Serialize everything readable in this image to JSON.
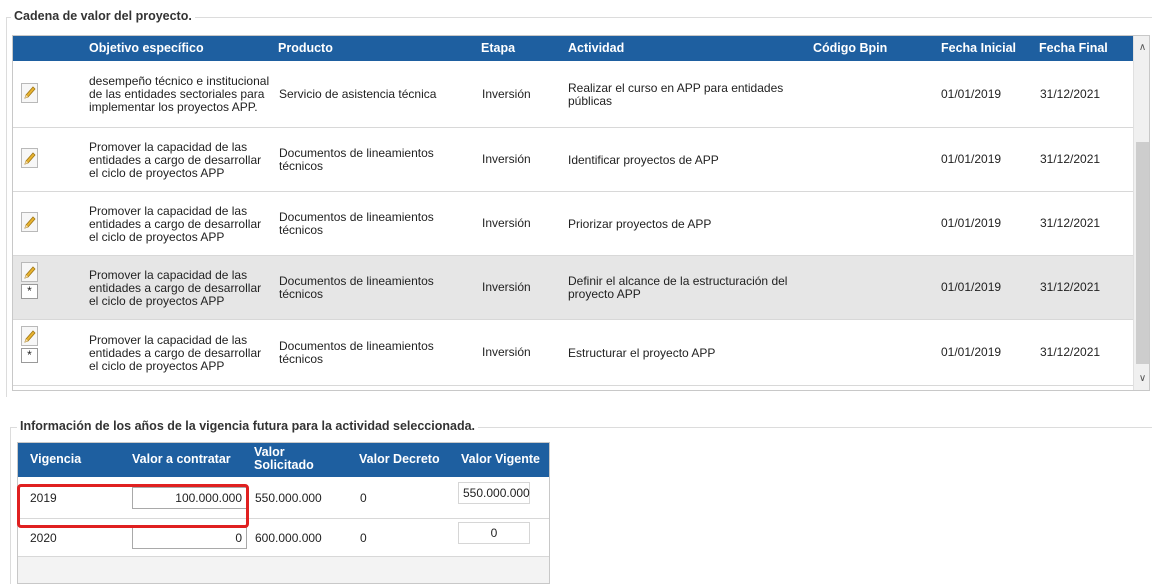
{
  "section1_title": "Cadena de valor del proyecto.",
  "grid": {
    "headers": {
      "objetivo": "Objetivo específico",
      "producto": "Producto",
      "etapa": "Etapa",
      "actividad": "Actividad",
      "codigo": "Código Bpin",
      "fecha_inicial": "Fecha Inicial",
      "fecha_final": "Fecha Final"
    },
    "rows": [
      {
        "objetivo": [
          "desempeño técnico e institucional",
          "de las entidades sectoriales para",
          "implementar los proyectos APP."
        ],
        "producto": [
          "Servicio de asistencia técnica"
        ],
        "etapa": "Inversión",
        "actividad": [
          "Realizar el curso en APP para entidades",
          "públicas"
        ],
        "fecha_inicial": "01/01/2019",
        "fecha_final": "31/12/2021",
        "selected": false,
        "star": false
      },
      {
        "objetivo": [
          "Promover la capacidad de las",
          "entidades a cargo de desarrollar",
          "el ciclo de proyectos APP"
        ],
        "producto": [
          "Documentos de lineamientos",
          "técnicos"
        ],
        "etapa": "Inversión",
        "actividad": [
          "Identificar proyectos de APP"
        ],
        "fecha_inicial": "01/01/2019",
        "fecha_final": "31/12/2021",
        "selected": false,
        "star": false
      },
      {
        "objetivo": [
          "Promover la capacidad de las",
          "entidades a cargo de desarrollar",
          "el ciclo de proyectos APP"
        ],
        "producto": [
          "Documentos de lineamientos",
          "técnicos"
        ],
        "etapa": "Inversión",
        "actividad": [
          "Priorizar proyectos de APP"
        ],
        "fecha_inicial": "01/01/2019",
        "fecha_final": "31/12/2021",
        "selected": false,
        "star": false
      },
      {
        "objetivo": [
          "Promover la capacidad de las",
          "entidades a cargo de desarrollar",
          "el ciclo de proyectos APP"
        ],
        "producto": [
          "Documentos de lineamientos",
          "técnicos"
        ],
        "etapa": "Inversión",
        "actividad": [
          "Definir el alcance de la estructuración del",
          "proyecto APP"
        ],
        "fecha_inicial": "01/01/2019",
        "fecha_final": "31/12/2021",
        "selected": true,
        "star": true
      },
      {
        "objetivo": [
          "Promover la capacidad de las",
          "entidades a cargo de desarrollar",
          "el ciclo de proyectos APP"
        ],
        "producto": [
          "Documentos de lineamientos",
          "técnicos"
        ],
        "etapa": "Inversión",
        "actividad": [
          "Estructurar el proyecto APP"
        ],
        "fecha_inicial": "01/01/2019",
        "fecha_final": "31/12/2021",
        "selected": false,
        "star": true
      }
    ],
    "star_glyph": "*"
  },
  "section2_title": "Información de los años de la vigencia futura para la actividad seleccionada.",
  "subgrid": {
    "headers": {
      "vigencia": "Vigencia",
      "valor_contratar": "Valor a contratar",
      "valor_solicitado": "Valor Solicitado",
      "valor_decreto": "Valor Decreto",
      "valor_vigente": "Valor Vigente"
    },
    "rows": [
      {
        "vigencia": "2019",
        "valor_contratar": "100.000.000",
        "valor_solicitado": "550.000.000",
        "valor_decreto": "0",
        "valor_vigente": "550.000.000"
      },
      {
        "vigencia": "2020",
        "valor_contratar": "0",
        "valor_solicitado": "600.000.000",
        "valor_decreto": "0",
        "valor_vigente": "0"
      }
    ]
  },
  "scroll": {
    "up": "∧",
    "down": "∨"
  },
  "colors": {
    "header_bg": "#1e5fa0",
    "selected_row": "#e6e6e6",
    "highlight": "#e02020",
    "pencil": "#e8b330"
  }
}
